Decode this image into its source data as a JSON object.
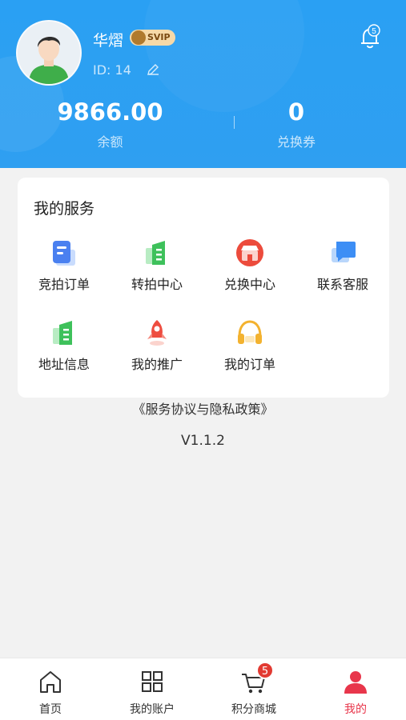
{
  "user": {
    "name": "华熠",
    "vip_label": "SVIP",
    "id_text": "ID: 14",
    "notification_count": "5"
  },
  "stats": {
    "balance_value": "9866.00",
    "balance_label": "余额",
    "coupons_value": "0",
    "coupons_label": "兑换券"
  },
  "services": {
    "title": "我的服务",
    "items": [
      {
        "label": "竞拍订单",
        "icon": "auction-order-icon",
        "color": "#4a80f0"
      },
      {
        "label": "转拍中心",
        "icon": "resale-center-icon",
        "color": "#3ec15b"
      },
      {
        "label": "兑换中心",
        "icon": "exchange-center-icon",
        "color": "#ec4b3c"
      },
      {
        "label": "联系客服",
        "icon": "customer-service-icon",
        "color": "#3d8ef5"
      },
      {
        "label": "地址信息",
        "icon": "address-icon",
        "color": "#3ec15b"
      },
      {
        "label": "我的推广",
        "icon": "rocket-icon",
        "color": "#ee4d40"
      },
      {
        "label": "我的订单",
        "icon": "headphones-icon",
        "color": "#f3b22f"
      }
    ]
  },
  "footer": {
    "policy_text": "《服务协议与隐私政策》",
    "version": "V1.1.2"
  },
  "tabbar": {
    "items": [
      {
        "label": "首页",
        "icon": "home-icon"
      },
      {
        "label": "我的账户",
        "icon": "grid-icon"
      },
      {
        "label": "积分商城",
        "icon": "cart-icon",
        "badge": "5"
      },
      {
        "label": "我的",
        "icon": "person-icon",
        "active": true
      }
    ]
  },
  "colors": {
    "header_blue": "#2aa0f3",
    "active_red": "#e8364b",
    "badge_red": "#e23a32"
  }
}
